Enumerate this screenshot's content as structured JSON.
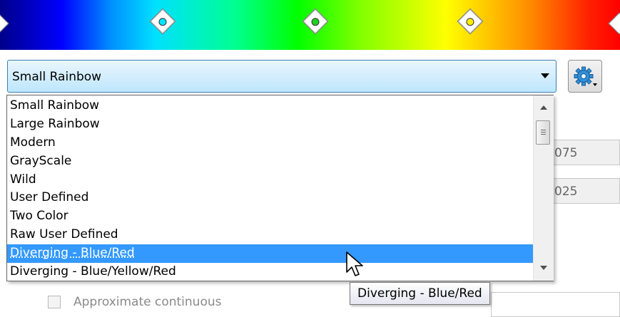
{
  "colormap_bar": {
    "markers": [
      {
        "name": "cyan",
        "color": "#00e5ff"
      },
      {
        "name": "green",
        "color": "#22cc22"
      },
      {
        "name": "yellow",
        "color": "#ffee00"
      }
    ]
  },
  "combo": {
    "selected_value": "Small Rainbow"
  },
  "background_fields": {
    "value_1": "075",
    "value_2": "025"
  },
  "dropdown": {
    "options": [
      "Small Rainbow",
      "Large Rainbow",
      "Modern",
      "GrayScale",
      "Wild",
      "User Defined",
      "Two Color",
      "Raw User Defined",
      "Diverging - Blue/Red",
      "Diverging - Blue/Yellow/Red"
    ],
    "highlighted": "Diverging - Blue/Red"
  },
  "tooltip": {
    "text": "Diverging - Blue/Red"
  },
  "checkbox": {
    "label": "Approximate continuous",
    "checked": false
  },
  "icons": {
    "gear": "gear-icon",
    "dropdown_arrow": "chevron-down-icon"
  }
}
